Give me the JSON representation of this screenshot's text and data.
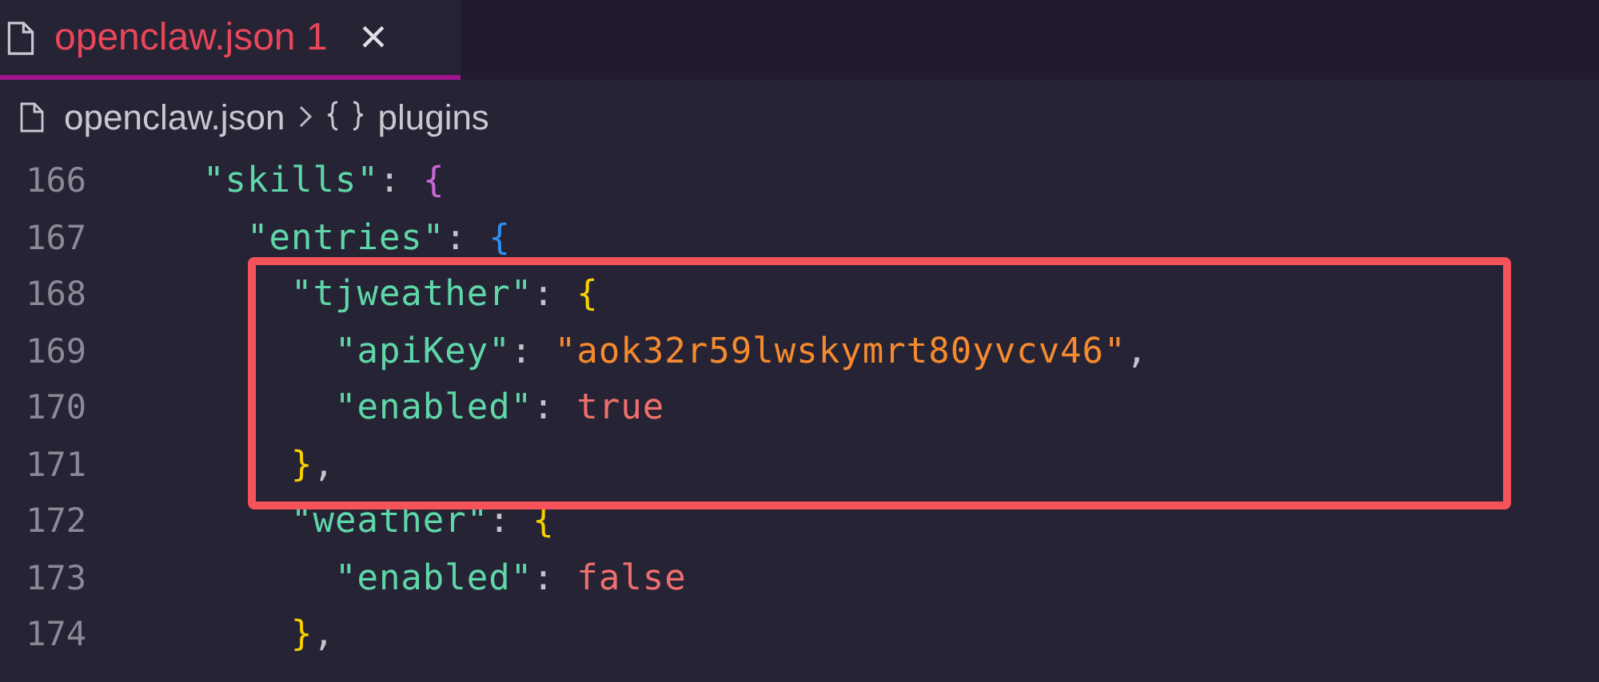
{
  "tab": {
    "label": "openclaw.json 1",
    "selected": true,
    "close": "×"
  },
  "breadcrumb": [
    {
      "label": "openclaw.json",
      "kind": "file"
    },
    {
      "label": "plugins",
      "kind": "object"
    }
  ],
  "lines": [
    {
      "number": "166",
      "highlighted": false,
      "tokens": [
        {
          "text": "    \"skills\"",
          "kind": "key"
        },
        {
          "text": ": ",
          "kind": "punct"
        },
        {
          "text": "{",
          "kind": "brace1"
        }
      ]
    },
    {
      "number": "167",
      "highlighted": false,
      "tokens": [
        {
          "text": "      \"entries\"",
          "kind": "key"
        },
        {
          "text": ": ",
          "kind": "punct"
        },
        {
          "text": "{",
          "kind": "brace2"
        }
      ]
    },
    {
      "number": "168",
      "highlighted": true,
      "tokens": [
        {
          "text": "        \"tjweather\"",
          "kind": "key"
        },
        {
          "text": ": ",
          "kind": "punct"
        },
        {
          "text": "{",
          "kind": "brace3"
        }
      ]
    },
    {
      "number": "169",
      "highlighted": true,
      "tokens": [
        {
          "text": "          \"apiKey\"",
          "kind": "key"
        },
        {
          "text": ": ",
          "kind": "punct"
        },
        {
          "text": "\"aok32r59lwskymrt80yvcv46\"",
          "kind": "string"
        },
        {
          "text": ",",
          "kind": "punct"
        }
      ]
    },
    {
      "number": "170",
      "highlighted": true,
      "tokens": [
        {
          "text": "          \"enabled\"",
          "kind": "key"
        },
        {
          "text": ": ",
          "kind": "punct"
        },
        {
          "text": "true",
          "kind": "literal"
        }
      ]
    },
    {
      "number": "171",
      "highlighted": true,
      "tokens": [
        {
          "text": "        }",
          "kind": "brace3"
        },
        {
          "text": ",",
          "kind": "punct"
        }
      ]
    },
    {
      "number": "172",
      "highlighted": false,
      "tokens": [
        {
          "text": "        \"weather\"",
          "kind": "key"
        },
        {
          "text": ": ",
          "kind": "punct"
        },
        {
          "text": "{",
          "kind": "brace3"
        }
      ]
    },
    {
      "number": "173",
      "highlighted": false,
      "tokens": [
        {
          "text": "          \"enabled\"",
          "kind": "key"
        },
        {
          "text": ": ",
          "kind": "punct"
        },
        {
          "text": "false",
          "kind": "literal"
        }
      ]
    },
    {
      "number": "174",
      "highlighted": false,
      "tokens": [
        {
          "text": "        }",
          "kind": "brace3"
        },
        {
          "text": ",",
          "kind": "punct"
        }
      ]
    }
  ]
}
